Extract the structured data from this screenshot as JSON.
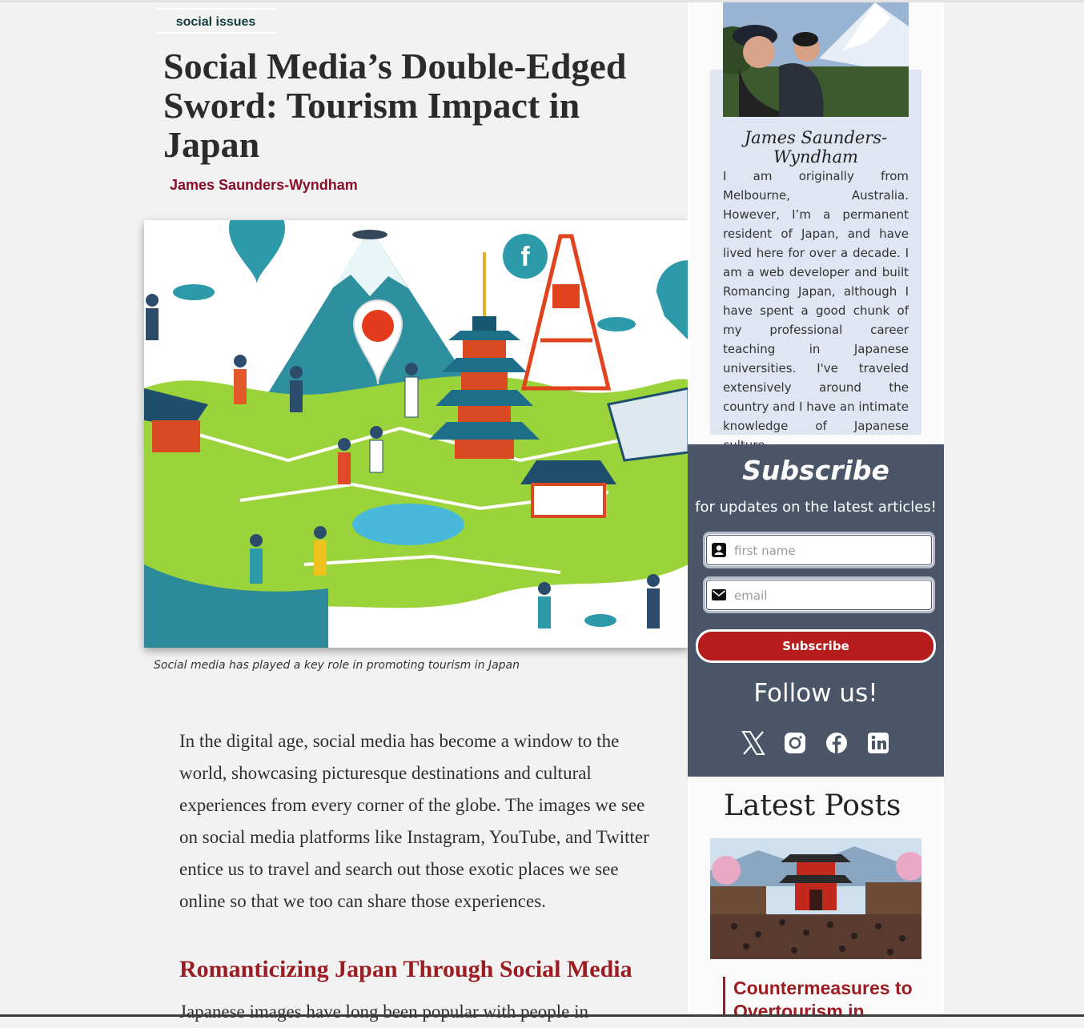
{
  "article": {
    "category": "social issues",
    "title": "Social Media’s Double-Edged Sword: Tourism Impact in Japan",
    "author": "James Saunders-Wyndham",
    "image_caption": "Social media has played a key role in promoting tourism in Japan",
    "intro_paragraph": "In the digital age, social media has become a window to the world, showcasing picturesque destinations and cultural experiences from every corner of the globe. The images we see on social media platforms like Instagram, YouTube, and Twitter entice us to travel and search out those exotic places we see online so that we too can share those experiences.",
    "section_heading": "Romanticizing Japan Through Social Media",
    "section_paragraph_start": "Japanese images have long been popular with people in"
  },
  "sidebar": {
    "author_card": {
      "name": "James Saunders-Wyndham",
      "bio": "I am originally from Melbourne, Australia. However, I’m a permanent resident of Japan, and have lived here for over a decade. I am a web developer and built Romancing Japan, although I have spent a good chunk of my professional career teaching in Japanese universities. I've traveled extensively around the country and I have an intimate knowledge of Japanese culture."
    },
    "subscribe": {
      "title": "Subscribe",
      "subtitle": "for updates on the latest articles!",
      "first_name_placeholder": "first name",
      "email_placeholder": "email",
      "button_label": "Subscribe"
    },
    "follow": {
      "title": "Follow us!",
      "icons": [
        "x-icon",
        "instagram-icon",
        "facebook-icon",
        "linkedin-icon"
      ]
    },
    "latest_posts": {
      "title": "Latest Posts",
      "items": [
        {
          "title": "Countermeasures to Overtourism in Japan:"
        }
      ]
    }
  },
  "colors": {
    "accent_red": "#9b1c21",
    "byline_red": "#8a0e2a",
    "subscribe_bg": "#4a5568",
    "button_red": "#b71c1c",
    "author_card_bg": "#dfe6f1"
  }
}
